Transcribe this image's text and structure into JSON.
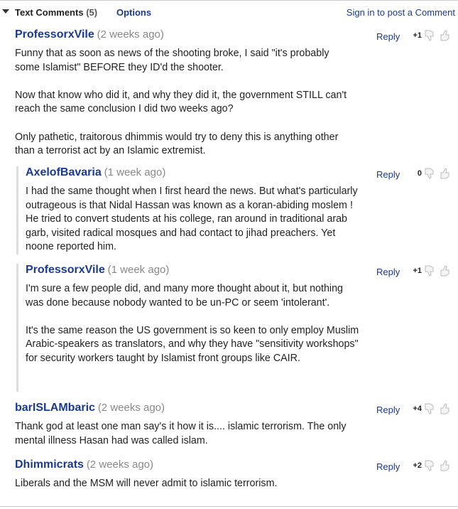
{
  "header": {
    "title": "Text Comments",
    "count": "(5)",
    "options": "Options",
    "signin": "Sign in to post a Comment"
  },
  "comments": [
    {
      "author": "ProfessorxVile",
      "time": "(2 weeks ago)",
      "body": "Funny that as soon as news of the shooting broke, I said \"it's probably some Islamist\" BEFORE they ID'd the shooter.\n\nNow that know who did it, and why they did it, the government STILL can't reach the same conclusion I did two weeks ago?\n\nOnly pathetic, traitorous dhimmis would try to deny this is anything other than a terrorist act by an Islamic extremist.",
      "reply": "Reply",
      "score": "+1"
    },
    {
      "author": "AxelofBavaria",
      "time": "(1 week ago)",
      "body": "I had the same thought when I first heard the news. But what's particularly outrageous is that Nidal Hassan was known as a koran-abiding moslem ! He tried to convert students at his college, ran around in traditional arab garb, visited radical mosques and had contact to jihad preachers. Yet noone reported him.",
      "reply": "Reply",
      "score": "0"
    },
    {
      "author": "ProfessorxVile",
      "time": "(1 week ago)",
      "body": "I'm sure a few people did, and many more thought about it, but nothing was done because nobody wanted to be un-PC or seem 'intolerant'.\n\nIt's the same reason the US government is so keen to only employ Muslim Arabic-speakers as translators, and why they have \"sensitivity workshops\" for security workers taught by Islamist front groups like CAIR.",
      "reply": "Reply",
      "score": "+1"
    },
    {
      "author": "barISLAMbaric",
      "time": "(2 weeks ago)",
      "body": "Thank god at least one man say's it how it is.... islamic terrorism. The only mental illness Hasan had was called islam.",
      "reply": "Reply",
      "score": "+4"
    },
    {
      "author": "Dhimmicrats",
      "time": "(2 weeks ago)",
      "body": "Liberals and the MSM will never admit to islamic terrorism.",
      "reply": "Reply",
      "score": "+2"
    }
  ]
}
